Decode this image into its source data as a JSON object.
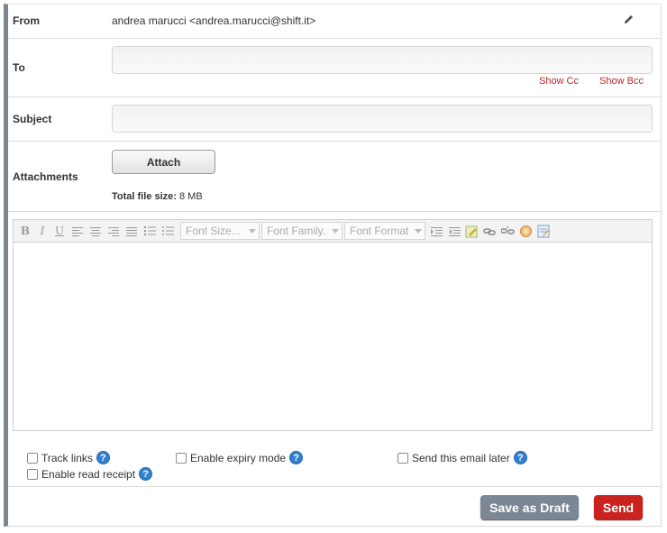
{
  "from": {
    "label": "From",
    "value": "andrea marucci <andrea.marucci@shift.it>",
    "edit_icon": "pencil-icon"
  },
  "to": {
    "label": "To",
    "value": "",
    "show_cc": "Show Cc",
    "show_bcc": "Show Bcc"
  },
  "subject": {
    "label": "Subject",
    "value": ""
  },
  "attachments": {
    "label": "Attachments",
    "button": "Attach",
    "filesize_label": "Total file size:",
    "filesize_value": "8 MB"
  },
  "editor": {
    "font_size": "Font Size...",
    "font_family": "Font Family.",
    "font_format": "Font Format",
    "bold": "B",
    "italic": "I",
    "underline": "U"
  },
  "options": {
    "track_links": "Track links",
    "expiry": "Enable expiry mode",
    "send_later": "Send this email later",
    "read_receipt": "Enable read receipt",
    "help": "?"
  },
  "actions": {
    "save_draft": "Save as Draft",
    "send": "Send"
  },
  "colors": {
    "link": "#b8262b",
    "send": "#c9221f",
    "draft": "#7b8794",
    "help": "#2f7fd0"
  }
}
